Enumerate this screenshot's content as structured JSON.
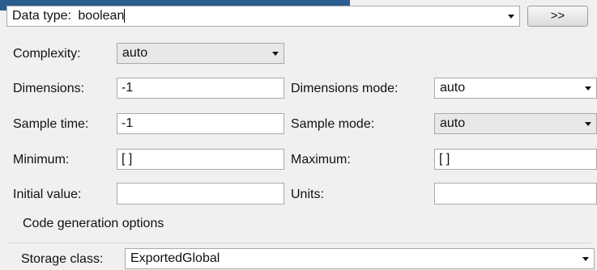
{
  "data_type": {
    "label": "Data type:",
    "value": "boolean",
    "more_button": ">>"
  },
  "complexity": {
    "label": "Complexity:",
    "value": "auto"
  },
  "dimensions": {
    "label": "Dimensions:",
    "value": "-1"
  },
  "dimensions_mode": {
    "label": "Dimensions mode:",
    "value": "auto"
  },
  "sample_time": {
    "label": "Sample time:",
    "value": "-1"
  },
  "sample_mode": {
    "label": "Sample mode:",
    "value": "auto"
  },
  "minimum": {
    "label": "Minimum:",
    "value": "[ ]"
  },
  "maximum": {
    "label": "Maximum:",
    "value": "[ ]"
  },
  "initial_value": {
    "label": "Initial value:",
    "value": ""
  },
  "units": {
    "label": "Units:",
    "value": ""
  },
  "code_generation": {
    "title": "Code generation options",
    "storage_class": {
      "label": "Storage class:",
      "value": "ExportedGlobal"
    }
  },
  "colors": {
    "title_bar": "#2b5d90",
    "panel_bg": "#f0f0f0"
  }
}
